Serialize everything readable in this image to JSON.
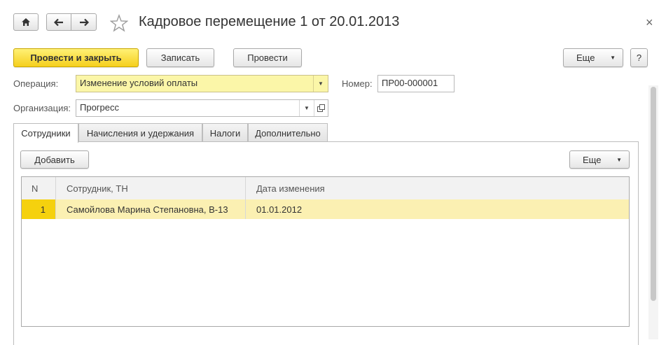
{
  "window": {
    "title": "Кадровое перемещение 1 от 20.01.2013",
    "close_glyph": "×",
    "icons": {
      "home": "home-icon",
      "back": "arrow-left-icon",
      "forward": "arrow-right-icon",
      "favorite": "star-icon"
    }
  },
  "toolbar": {
    "post_and_close": "Провести и закрыть",
    "save": "Записать",
    "post": "Провести",
    "more": "Еще",
    "help": "?"
  },
  "form": {
    "operation_label": "Операция:",
    "operation_value": "Изменение условий оплаты",
    "number_label": "Номер:",
    "number_value": "ПР00-000001",
    "organization_label": "Организация:",
    "organization_value": "Прогресс"
  },
  "tabs": [
    {
      "label": "Сотрудники",
      "active": true
    },
    {
      "label": "Начисления и удержания",
      "active": false
    },
    {
      "label": "Налоги",
      "active": false
    },
    {
      "label": "Дополнительно",
      "active": false
    }
  ],
  "employees": {
    "add_label": "Добавить",
    "more_label": "Еще",
    "columns": [
      "N",
      "Сотрудник, ТН",
      "Дата изменения"
    ],
    "rows": [
      {
        "n": "1",
        "employee": "Самойлова Марина Степановна, В-13",
        "date": "01.01.2012"
      }
    ]
  },
  "colors": {
    "primary_button": "#f5cf1d",
    "field_highlight": "#fbf6a8",
    "selected_row": "#fbf0b2"
  }
}
